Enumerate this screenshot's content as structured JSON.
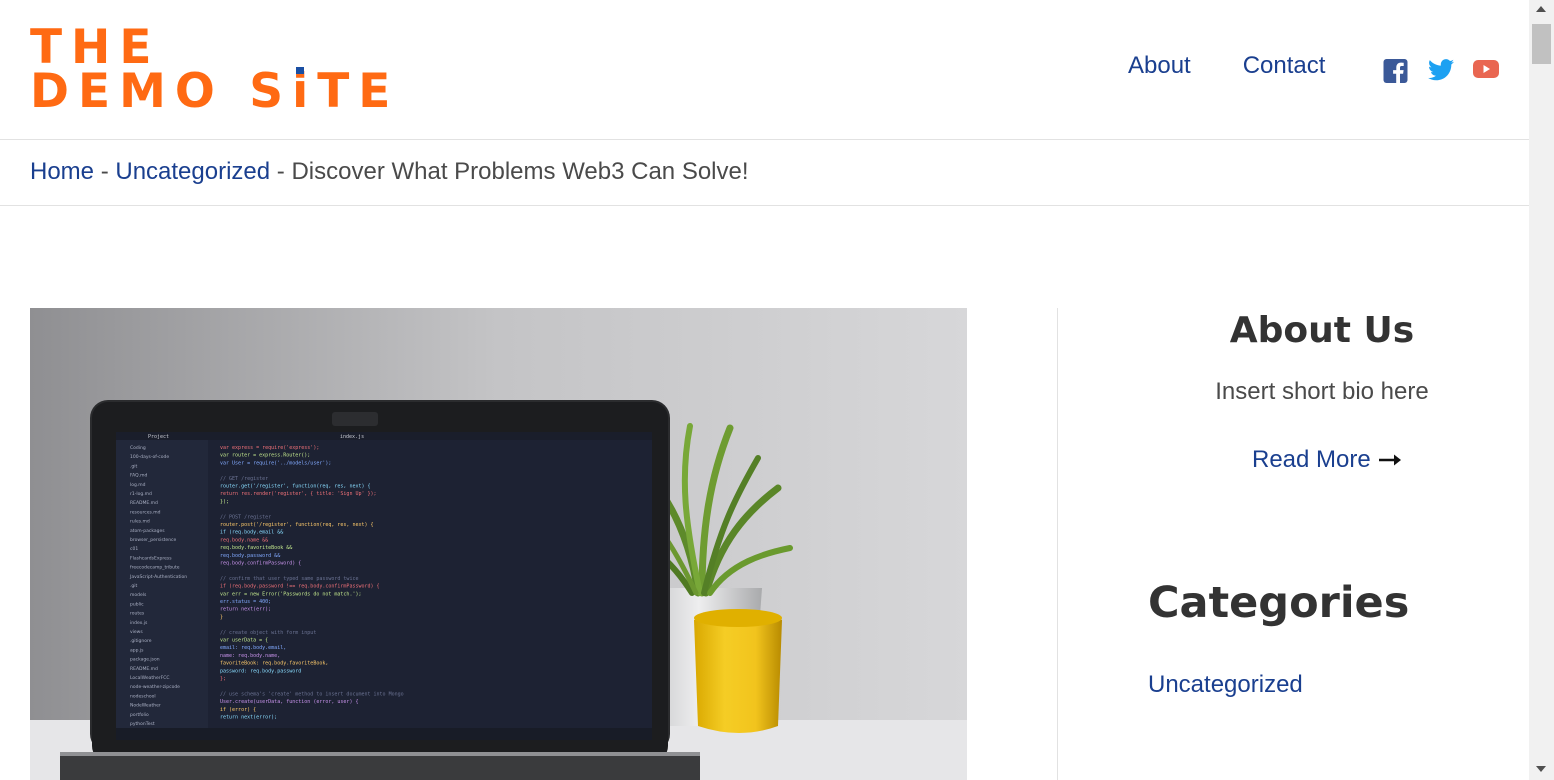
{
  "header": {
    "logo_line1": "THE",
    "logo_line2_a": "DEMO S",
    "logo_line2_i": "i",
    "logo_line2_b": "TE",
    "nav": [
      {
        "label": "About"
      },
      {
        "label": "Contact"
      }
    ],
    "social": [
      {
        "icon": "facebook-icon",
        "color": "#3b5998"
      },
      {
        "icon": "twitter-icon",
        "color": "#1da1f2"
      },
      {
        "icon": "youtube-icon",
        "color": "#e96651"
      }
    ]
  },
  "breadcrumb": {
    "home": "Home",
    "sep1": " - ",
    "category": "Uncategorized",
    "sep2": " - ",
    "current": "Discover What Problems Web3 Can Solve!"
  },
  "sidebar": {
    "about_title": "About Us",
    "about_bio": "Insert short bio here",
    "read_more": "Read More",
    "categories_title": "Categories",
    "categories": [
      "Uncategorized"
    ]
  },
  "code_screen": {
    "tab1": "Project",
    "tab2": "index.js",
    "lines": [
      "var express = require('express');",
      "var router = express.Router();",
      "var User = require('../models/user');",
      "",
      "// GET /register",
      "router.get('/register', function(req, res, next) {",
      "  return res.render('register', { title: 'Sign Up' });",
      "});",
      "",
      "// POST /register",
      "router.post('/register', function(req, res, next) {",
      "  if (req.body.email &&",
      "    req.body.name &&",
      "    req.body.favoriteBook &&",
      "    req.body.password &&",
      "    req.body.confirmPassword) {",
      "",
      "      // confirm that user typed same password twice",
      "      if (req.body.password !== req.body.confirmPassword) {",
      "        var err = new Error('Passwords do not match.');",
      "        err.status = 400;",
      "        return next(err);",
      "      }",
      "",
      "      // create object with form input",
      "      var userData = {",
      "        email: req.body.email,",
      "        name: req.body.name,",
      "        favoriteBook: req.body.favoriteBook,",
      "        password: req.body.password",
      "      };",
      "",
      "      // use schema's 'create' method to insert document into Mongo",
      "      User.create(userData, function (error, user) {",
      "        if (error) {",
      "          return next(error);"
    ],
    "files": [
      "Coding",
      "100-days-of-code",
      ".git",
      "FAQ.md",
      "log.md",
      "r1-log.md",
      "README.md",
      "resources.md",
      "rules.md",
      "atom-packages",
      "browser_persistence",
      "c01",
      "FlashcardsExpress",
      "freecodecamp_tribute",
      "JavaScript-Authentication",
      ".git",
      "models",
      "public",
      "routes",
      "index.js",
      "views",
      ".gitignore",
      "app.js",
      "package.json",
      "README.md",
      "LocalWeatherFCC",
      "node-weather-zipcode",
      "nodeschool",
      "NodeWeather",
      "portfolio",
      "pythonTest"
    ]
  }
}
